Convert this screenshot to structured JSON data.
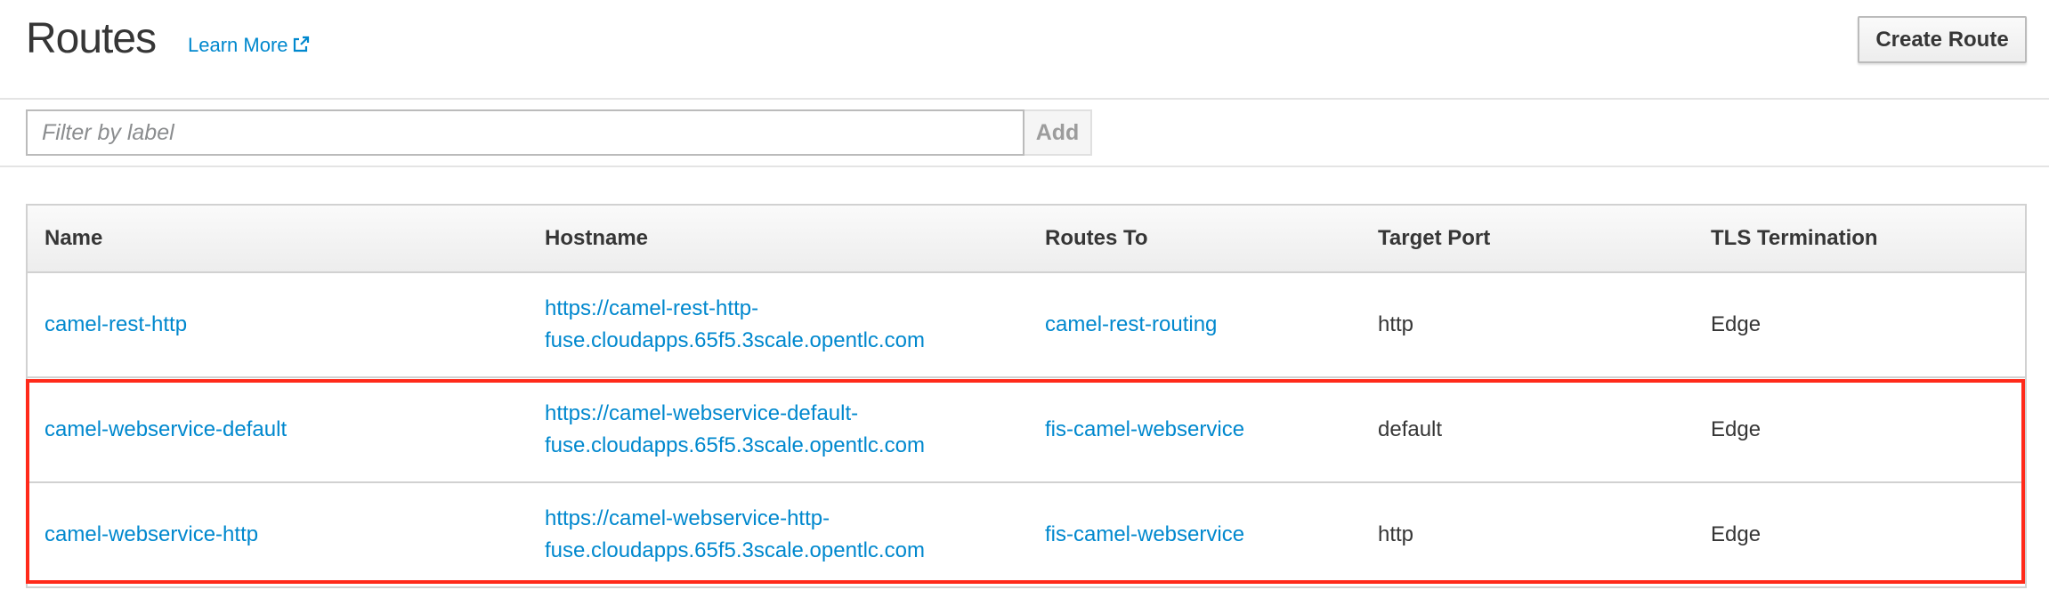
{
  "header": {
    "title": "Routes",
    "learn_more": "Learn More",
    "create_button": "Create Route"
  },
  "filter": {
    "placeholder": "Filter by label",
    "value": "",
    "add_button": "Add"
  },
  "table": {
    "columns": [
      "Name",
      "Hostname",
      "Routes To",
      "Target Port",
      "TLS Termination"
    ],
    "rows": [
      {
        "name": "camel-rest-http",
        "hostname": "https://camel-rest-http-fuse.cloudapps.65f5.3scale.opentlc.com",
        "routes_to": "camel-rest-routing",
        "target_port": "http",
        "tls": "Edge"
      },
      {
        "name": "camel-webservice-default",
        "hostname": "https://camel-webservice-default-fuse.cloudapps.65f5.3scale.opentlc.com",
        "routes_to": "fis-camel-webservice",
        "target_port": "default",
        "tls": "Edge"
      },
      {
        "name": "camel-webservice-http",
        "hostname": "https://camel-webservice-http-fuse.cloudapps.65f5.3scale.opentlc.com",
        "routes_to": "fis-camel-webservice",
        "target_port": "http",
        "tls": "Edge"
      }
    ]
  },
  "colors": {
    "link": "#0088ce",
    "highlight": "#ff2a1a"
  }
}
